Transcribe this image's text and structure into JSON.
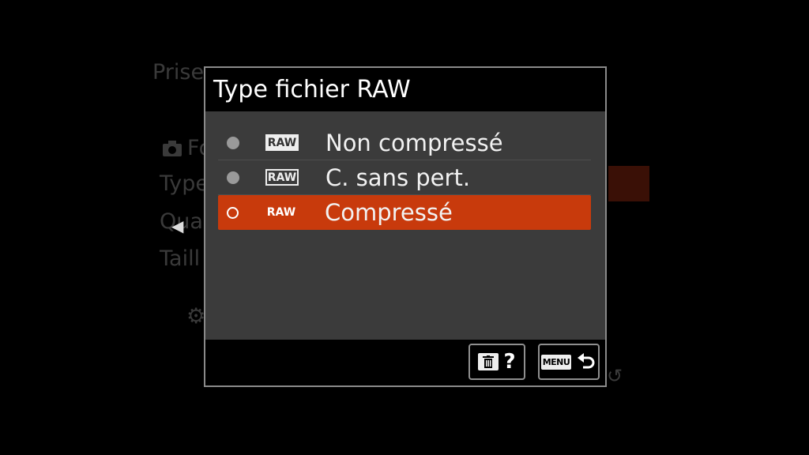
{
  "background": {
    "tab_text": "Prise",
    "camera_row": "Fo",
    "type_row": "Type",
    "quality_row": "Qua",
    "taille_row": "Taill"
  },
  "dialog": {
    "title": "Type fichier RAW",
    "options": [
      {
        "label": "Non compressé",
        "raw_badge": "RAW",
        "selected": false
      },
      {
        "label": "C. sans pert.",
        "raw_badge": "RAW",
        "selected": false
      },
      {
        "label": "Compressé",
        "raw_badge": "RAW",
        "selected": true
      }
    ],
    "footer": {
      "help_label": "?",
      "menu_label": "MENU"
    }
  },
  "colors": {
    "selection": "#c83a0c",
    "dialog_bg": "#3b3b3b"
  },
  "icons": [
    "camera-icon",
    "gear-icon",
    "trash-icon",
    "back-arrow-icon",
    "radio-icon"
  ]
}
